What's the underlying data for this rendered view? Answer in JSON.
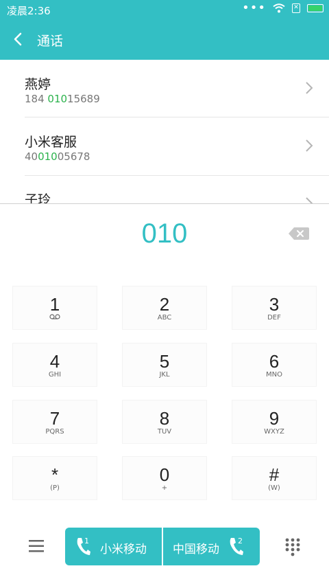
{
  "status_bar": {
    "time": "凌晨2:36"
  },
  "header": {
    "title": "通话"
  },
  "contacts": [
    {
      "name": "燕婷",
      "number_pre": "184 ",
      "number_match": "010",
      "number_post": "15689"
    },
    {
      "name": "小米客服",
      "number_pre": "40",
      "number_match": "010",
      "number_post": "05678"
    },
    {
      "name": "子玲",
      "number_pre": "",
      "number_match": "",
      "number_post": ""
    }
  ],
  "dial": {
    "digits": "010"
  },
  "keypad": [
    {
      "num": "1",
      "sub": ""
    },
    {
      "num": "2",
      "sub": "ABC"
    },
    {
      "num": "3",
      "sub": "DEF"
    },
    {
      "num": "4",
      "sub": "GHI"
    },
    {
      "num": "5",
      "sub": "JKL"
    },
    {
      "num": "6",
      "sub": "MNO"
    },
    {
      "num": "7",
      "sub": "PQRS"
    },
    {
      "num": "8",
      "sub": "TUV"
    },
    {
      "num": "9",
      "sub": "WXYZ"
    },
    {
      "num": "*",
      "sub": "(P)"
    },
    {
      "num": "0",
      "sub": "+"
    },
    {
      "num": "#",
      "sub": "(W)"
    }
  ],
  "call_buttons": [
    {
      "label": "小米移动",
      "sim": "1"
    },
    {
      "label": "中国移动",
      "sim": "2"
    }
  ],
  "colors": {
    "accent": "#33bfc4",
    "match": "#2bb24c"
  }
}
